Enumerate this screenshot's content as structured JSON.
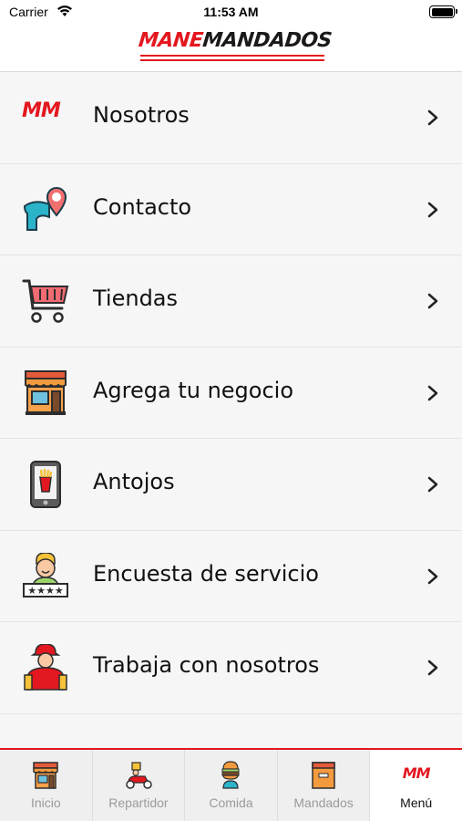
{
  "status_bar": {
    "carrier": "Carrier",
    "time": "11:53 AM"
  },
  "header": {
    "logo_part1": "MANE",
    "logo_part2": "MANDADOS"
  },
  "menu": {
    "items": [
      {
        "label": "Nosotros",
        "icon": "mm-logo-icon"
      },
      {
        "label": "Contacto",
        "icon": "map-pin-icon"
      },
      {
        "label": "Tiendas",
        "icon": "shopping-cart-icon"
      },
      {
        "label": "Agrega tu negocio",
        "icon": "storefront-icon"
      },
      {
        "label": "Antojos",
        "icon": "phone-fries-icon"
      },
      {
        "label": "Encuesta de servicio",
        "icon": "rating-person-icon"
      },
      {
        "label": "Trabaja con nosotros",
        "icon": "delivery-person-icon"
      },
      {
        "label": "",
        "icon": "partial-icon"
      }
    ],
    "mm_text": "MM"
  },
  "tabbar": {
    "tabs": [
      {
        "label": "Inicio",
        "icon": "store-icon",
        "active": false
      },
      {
        "label": "Repartidor",
        "icon": "scooter-icon",
        "active": false
      },
      {
        "label": "Comida",
        "icon": "burger-icon",
        "active": false
      },
      {
        "label": "Mandados",
        "icon": "package-icon",
        "active": false
      },
      {
        "label": "Menú",
        "icon": "mm-logo-icon",
        "active": true
      }
    ]
  },
  "colors": {
    "brand_red": "#e3171f",
    "teal": "#2bb3c9"
  }
}
